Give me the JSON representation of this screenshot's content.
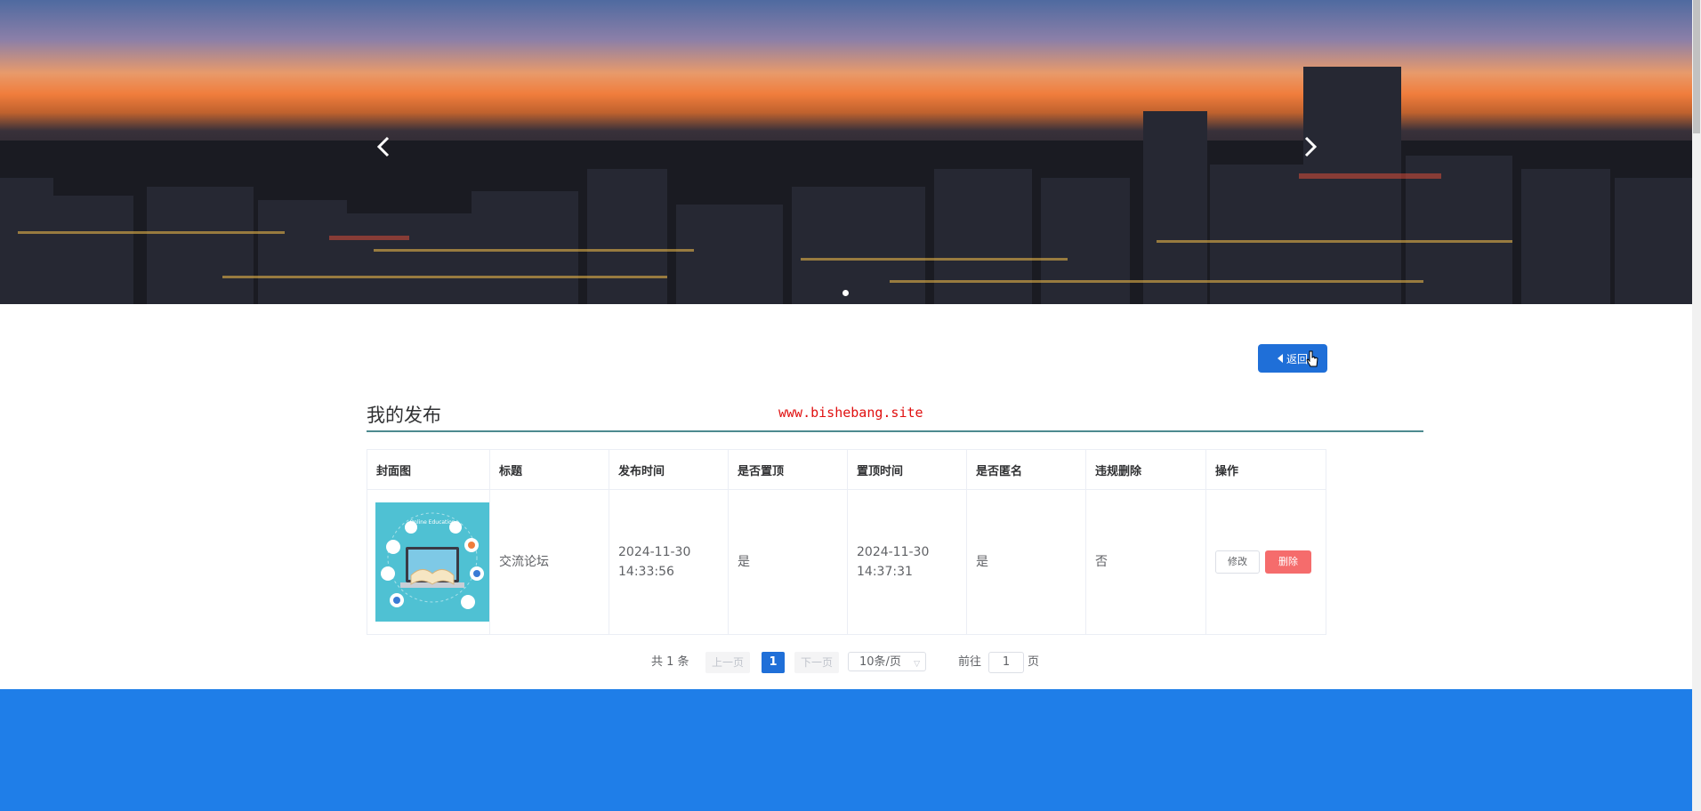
{
  "banner": {
    "prev": "previous-slide",
    "next": "next-slide",
    "active_index": 1
  },
  "page": {
    "back_label": "返回",
    "section_title": "我的发布",
    "watermark": "www.bishebang.site"
  },
  "table": {
    "columns": [
      "封面图",
      "标题",
      "发布时间",
      "是否置顶",
      "置顶时间",
      "是否匿名",
      "违规删除",
      "操作"
    ],
    "rows": [
      {
        "title": "交流论坛",
        "publish_time": "2024-11-30 14:33:56",
        "is_top": "是",
        "top_time": "2024-11-30 14:37:31",
        "is_anonymous": "是",
        "violation_deleted": "否",
        "edit_label": "修改",
        "delete_label": "删除",
        "cover_text": "Online Education"
      }
    ]
  },
  "pagination": {
    "total": "共 1 条",
    "prev": "上一页",
    "current": "1",
    "next": "下一页",
    "page_size": "10条/页",
    "goto_label": "前往",
    "goto_value": "1",
    "page_unit": "页"
  },
  "colors": {
    "primary": "#1f6fd8",
    "footer": "#1f7ee8",
    "danger": "#f56c6c",
    "watermark": "#e01010"
  }
}
